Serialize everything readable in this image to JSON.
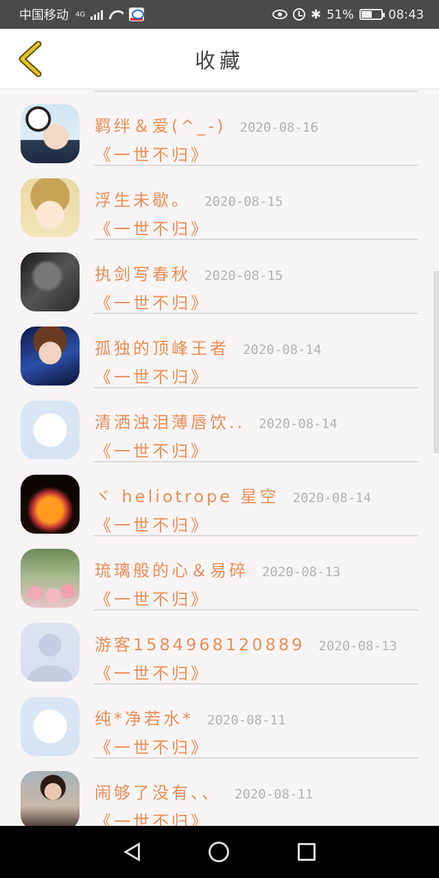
{
  "status_bar": {
    "carrier": "中国移动",
    "network": "4G",
    "battery_text": "51%",
    "battery_level": 0.51,
    "time": "08:43"
  },
  "header": {
    "title": "收藏",
    "back_icon": "chevron-left-icon"
  },
  "colors": {
    "accent": "#ec8e55",
    "back_icon": "#e7c323",
    "date": "#b3b3b3"
  },
  "list": {
    "items": [
      {
        "name": "羁绊＆爱(^_-)",
        "date": "2020-08-16",
        "book": "《一世不归》",
        "avatar": "avatar-boy-soccer"
      },
      {
        "name": "浮生未歇。",
        "date": "2020-08-15",
        "book": "《一世不归》",
        "avatar": "avatar-cartoon-bear"
      },
      {
        "name": "执剑写春秋",
        "date": "2020-08-15",
        "book": "《一世不归》",
        "avatar": "avatar-dark-portrait"
      },
      {
        "name": "孤独的顶峰王者",
        "date": "2020-08-14",
        "book": "《一世不归》",
        "avatar": "avatar-anime-boy"
      },
      {
        "name": "清洒浊泪薄唇饮..",
        "date": "2020-08-14",
        "book": "《一世不归》",
        "avatar": "avatar-default-qq"
      },
      {
        "name": "ヾ heliotrope 星空",
        "date": "2020-08-14",
        "book": "《一世不归》",
        "avatar": "avatar-love-fire"
      },
      {
        "name": "琉璃般的心＆易碎",
        "date": "2020-08-13",
        "book": "《一世不归》",
        "avatar": "avatar-tulips"
      },
      {
        "name": "游客1584968120889",
        "date": "2020-08-13",
        "book": "《一世不归》",
        "avatar": "avatar-default-person"
      },
      {
        "name": "纯*净若水*",
        "date": "2020-08-11",
        "book": "《一世不归》",
        "avatar": "avatar-default-qq"
      },
      {
        "name": "闹够了没有、、",
        "date": "2020-08-11",
        "book": "《一世不归》",
        "avatar": "avatar-girl-photo"
      }
    ]
  }
}
